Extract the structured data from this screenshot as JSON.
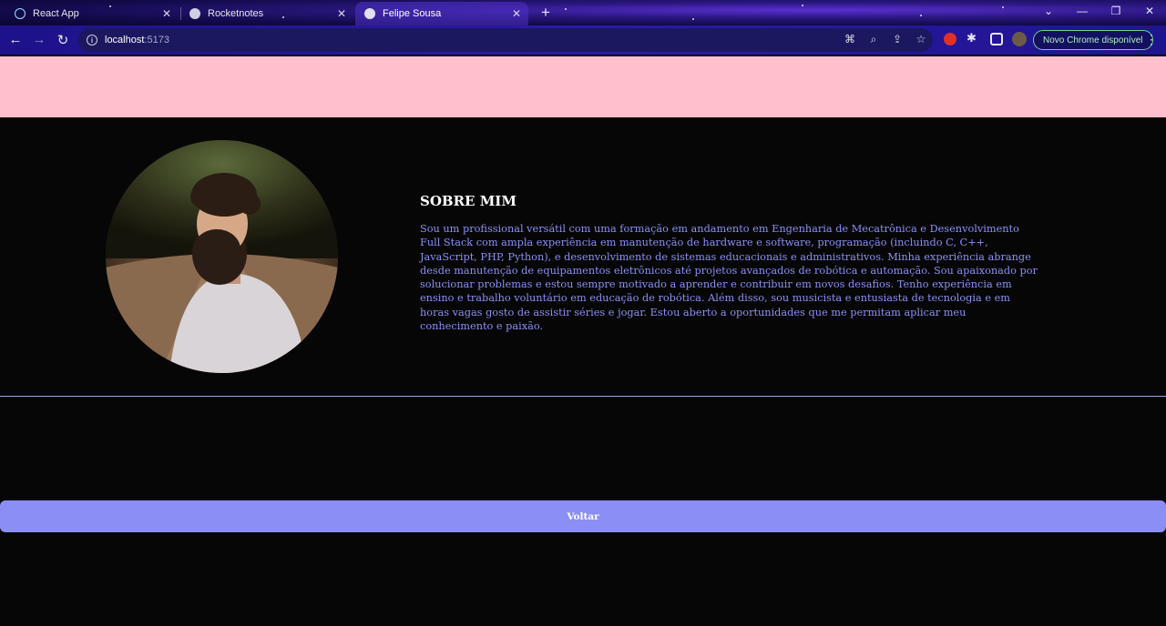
{
  "browser": {
    "tabs": [
      {
        "title": "React App",
        "active": false
      },
      {
        "title": "Rocketnotes",
        "active": false
      },
      {
        "title": "Felipe Sousa",
        "active": true
      }
    ],
    "address": {
      "host": "localhost",
      "port": ":5173"
    },
    "update_label": "Novo Chrome disponível"
  },
  "about": {
    "title": "SOBRE MIM",
    "text": "Sou um profissional versátil com uma formação em andamento em Engenharia de Mecatrônica e Desenvolvimento Full Stack com ampla experiência em manutenção de hardware e software, programação (incluindo C, C++, JavaScript, PHP, Python), e desenvolvimento de sistemas educacionais e administrativos. Minha experiência abrange desde manutenção de equipamentos eletrônicos até projetos avançados de robótica e automação. Sou apaixonado por solucionar problemas e estou sempre motivado a aprender e contribuir em novos desafios. Tenho experiência em ensino e trabalho voluntário em educação de robótica. Além disso, sou musicista e entusiasta de tecnologia e em horas vagas gosto de assistir séries e jogar. Estou aberto a oportunidades que me permitam aplicar meu conhecimento e paixão."
  },
  "actions": {
    "back_label": "Voltar"
  },
  "colors": {
    "header_pink": "#ffbfcd",
    "accent": "#8b8ef4",
    "background": "#060607"
  }
}
